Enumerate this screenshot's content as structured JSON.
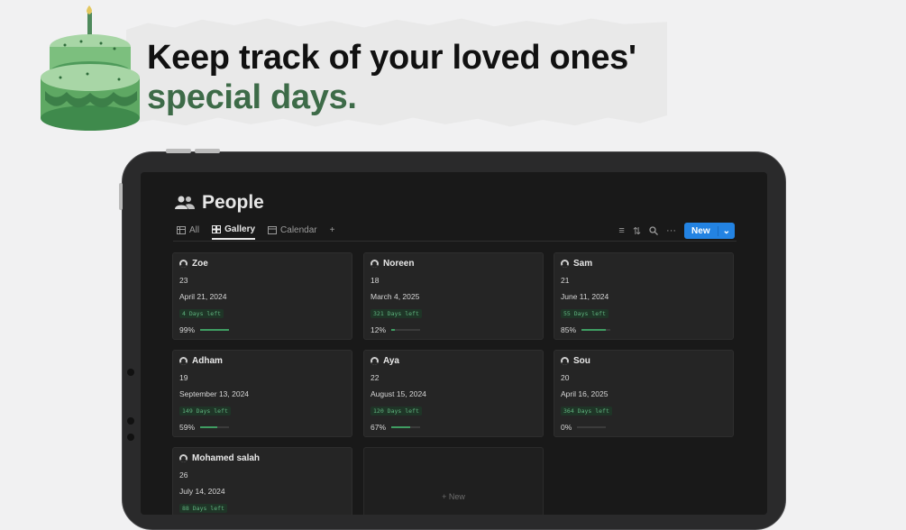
{
  "headline": {
    "line1": "Keep track of your loved ones'",
    "line2": "special days."
  },
  "page": {
    "title": "People"
  },
  "tabs": [
    {
      "label": "All",
      "icon": "table-icon",
      "active": false
    },
    {
      "label": "Gallery",
      "icon": "gallery-icon",
      "active": true
    },
    {
      "label": "Calendar",
      "icon": "calendar-icon",
      "active": false
    }
  ],
  "toolbar": {
    "new_label": "New"
  },
  "cards": [
    {
      "name": "Zoe",
      "age": "23",
      "date": "April 21, 2024",
      "days": "4 Days left",
      "pct": "99%",
      "progress": 0.99
    },
    {
      "name": "Noreen",
      "age": "18",
      "date": "March 4, 2025",
      "days": "321 Days left",
      "pct": "12%",
      "progress": 0.12
    },
    {
      "name": "Sam",
      "age": "21",
      "date": "June 11, 2024",
      "days": "55 Days left",
      "pct": "85%",
      "progress": 0.85
    },
    {
      "name": "Adham",
      "age": "19",
      "date": "September 13, 2024",
      "days": "149 Days left",
      "pct": "59%",
      "progress": 0.59
    },
    {
      "name": "Aya",
      "age": "22",
      "date": "August 15, 2024",
      "days": "120 Days left",
      "pct": "67%",
      "progress": 0.67
    },
    {
      "name": "Sou",
      "age": "20",
      "date": "April 16, 2025",
      "days": "364 Days left",
      "pct": "0%",
      "progress": 0.0
    },
    {
      "name": "Mohamed salah",
      "age": "26",
      "date": "July 14, 2024",
      "days": "88 Days left",
      "pct": "",
      "progress": null
    }
  ],
  "new_card": {
    "label": "+ New"
  },
  "colors": {
    "accent": "#2383e2",
    "progress": "#3f9d62",
    "headline_green": "#3d6b48"
  }
}
